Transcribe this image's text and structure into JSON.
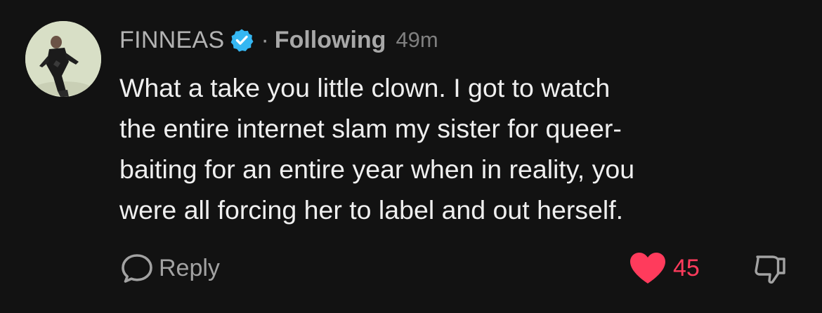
{
  "comment": {
    "author": "FINNEAS",
    "verified_icon": "verified-badge-icon",
    "separator": "·",
    "follow_status": "Following",
    "timestamp": "49m",
    "text_lines": [
      "What a take you little clown. I got to watch",
      "the entire internet slam my sister for queer-",
      "baiting for an entire year when in reality, you",
      "were all forcing her to label and out herself."
    ],
    "actions": {
      "reply_label": "Reply",
      "like_count": "45"
    }
  },
  "colors": {
    "background": "#121212",
    "verified_blue": "#35b7f2",
    "like_red": "#ff3b5c"
  }
}
